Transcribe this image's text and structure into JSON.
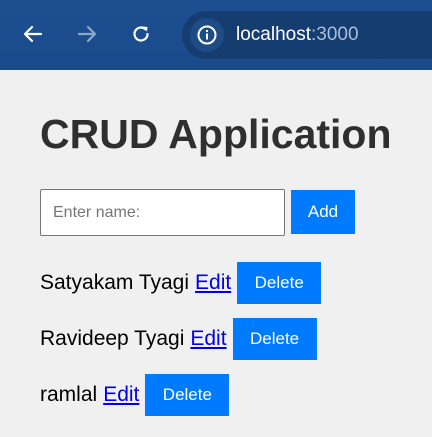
{
  "browser": {
    "back_icon": "arrow-left-icon",
    "forward_icon": "arrow-right-icon",
    "reload_icon": "reload-icon",
    "site_info_icon": "info-icon",
    "url_host": "localhost",
    "url_port": ":3000"
  },
  "page": {
    "title": "CRUD Application",
    "input_placeholder": "Enter name:",
    "input_value": "",
    "add_label": "Add"
  },
  "items": [
    {
      "name": "Satyakam Tyagi",
      "edit_label": "Edit",
      "delete_label": "Delete"
    },
    {
      "name": "Ravideep Tyagi",
      "edit_label": "Edit",
      "delete_label": "Delete"
    },
    {
      "name": "ramlal",
      "edit_label": "Edit",
      "delete_label": "Delete"
    }
  ],
  "colors": {
    "toolbar": "#1d4f91",
    "button": "#007bff",
    "link": "#0000ee",
    "background": "#f0f0f0"
  }
}
